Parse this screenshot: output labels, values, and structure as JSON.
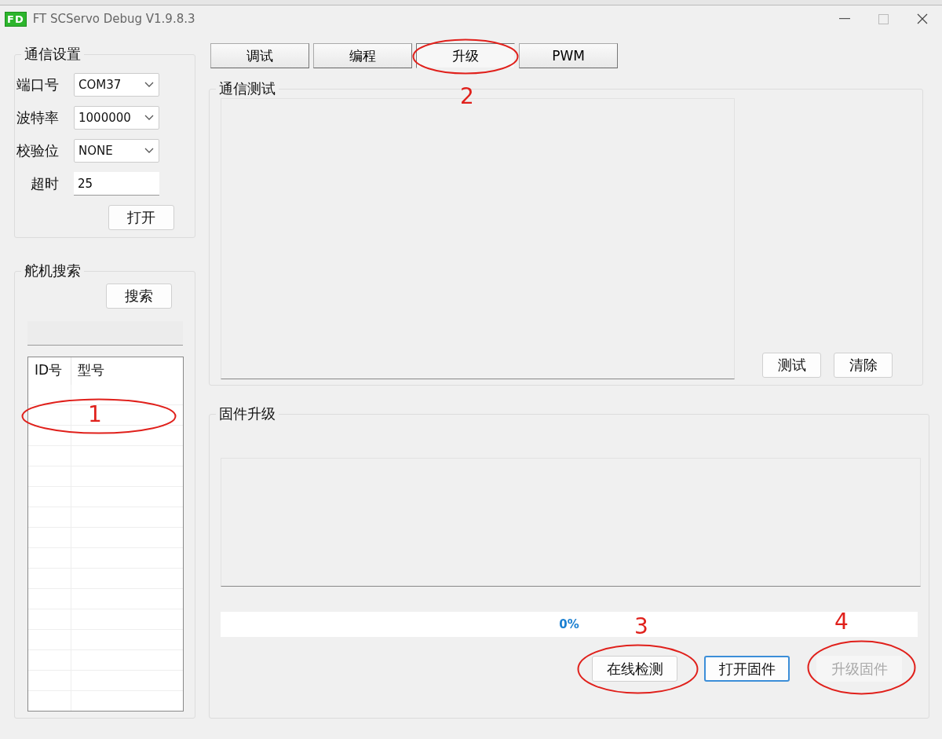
{
  "window": {
    "logo": "FD",
    "title": "FT SCServo Debug V1.9.8.3"
  },
  "comm_settings": {
    "title": "通信设置",
    "fields": [
      {
        "label": "端口号",
        "kind": "combo",
        "value": "COM37"
      },
      {
        "label": "波特率",
        "kind": "combo",
        "value": "1000000"
      },
      {
        "label": "校验位",
        "kind": "combo",
        "value": "NONE"
      },
      {
        "label": "超时",
        "kind": "text",
        "value": "25"
      }
    ],
    "button": "打开"
  },
  "servo_search": {
    "title": "舵机搜索",
    "button": "搜索",
    "columns": [
      "ID号",
      "型号"
    ]
  },
  "tabs": [
    {
      "label": "调试",
      "selected": false
    },
    {
      "label": "编程",
      "selected": false
    },
    {
      "label": "升级",
      "selected": true
    },
    {
      "label": "PWM",
      "selected": false
    }
  ],
  "comm_test": {
    "title": "通信测试",
    "buttons": [
      "测试",
      "清除"
    ]
  },
  "firmware": {
    "title": "固件升级",
    "progress": {
      "level": 0,
      "reading": "0%"
    },
    "buttons": [
      {
        "label": "在线检测",
        "disabled": false,
        "focused": false
      },
      {
        "label": "打开固件",
        "disabled": false,
        "focused": true
      },
      {
        "label": "升级固件",
        "disabled": true,
        "focused": false
      }
    ]
  },
  "annotations": [
    "1",
    "2",
    "3",
    "4"
  ]
}
